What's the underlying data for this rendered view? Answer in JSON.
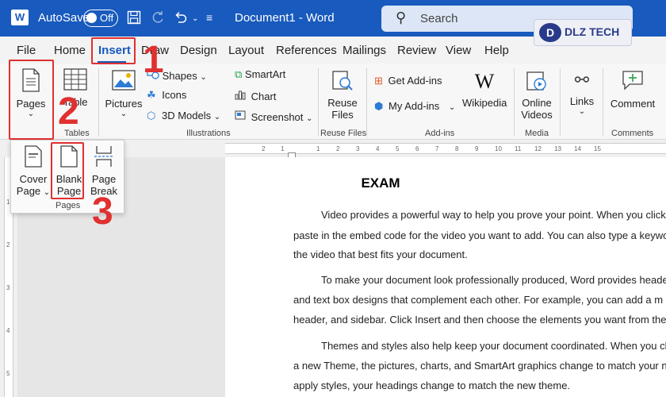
{
  "titlebar": {
    "app_icon": "word-app-icon",
    "autosave_label": "AutoSave",
    "autosave_state": "Off",
    "doc_title": "Document1  -  Word",
    "search_placeholder": "Search",
    "watermark_text": "DLZ TECH",
    "watermark_logo": "D"
  },
  "tabs": [
    "File",
    "Home",
    "Insert",
    "Draw",
    "Design",
    "Layout",
    "References",
    "Mailings",
    "Review",
    "View",
    "Help"
  ],
  "active_tab": "Insert",
  "ribbon": {
    "pages": {
      "label": "Pages"
    },
    "table": {
      "label": "Table"
    },
    "tables_group": "Tables",
    "pictures": {
      "label": "Pictures"
    },
    "shapes": "Shapes",
    "icons": "Icons",
    "models3d": "3D Models",
    "smartart": "SmartArt",
    "chart": "Chart",
    "screenshot": "Screenshot",
    "illustrations_group": "Illustrations",
    "reuse_files_line1": "Reuse",
    "reuse_files_line2": "Files",
    "reuse_files_group": "Reuse Files",
    "get_addins": "Get Add-ins",
    "my_addins": "My Add-ins",
    "wikipedia": "Wikipedia",
    "addins_group": "Add-ins",
    "online_videos_line1": "Online",
    "online_videos_line2": "Videos",
    "media_group": "Media",
    "links": "Links",
    "comment": "Comment",
    "comments_group": "Comments"
  },
  "pages_dropdown": {
    "cover_page_line1": "Cover",
    "cover_page_line2": "Page",
    "blank_page_line1": "Blank",
    "blank_page_line2": "Page",
    "page_break_line1": "Page",
    "page_break_line2": "Break",
    "group": "Pages"
  },
  "ruler_numbers": [
    "1",
    "2",
    "3",
    "4",
    "5",
    "6",
    "7",
    "8",
    "9",
    "10",
    "11",
    "12",
    "13",
    "14",
    "15"
  ],
  "ruler_numbers_left": [
    "1",
    "2"
  ],
  "vruler_numbers": [
    "1",
    "2",
    "3",
    "4",
    "5"
  ],
  "document": {
    "title": "EXAM",
    "lines": [
      "Video provides a powerful way to help you prove your point. When you click O",
      "paste in the embed code for the video you want to add. You can also type a keyword",
      "the video that best fits your document.",
      "To make your document look professionally produced, Word provides header,",
      "and text box designs that complement each other. For example, you can add a m",
      "header, and sidebar. Click Insert and then choose the elements you want from the dif",
      "Themes and styles also help keep your document coordinated. When you click",
      "a new Theme, the pictures, charts, and SmartArt graphics change to match your ne",
      "apply styles, your headings change to match the new theme."
    ]
  },
  "annotations": [
    "1",
    "2",
    "3"
  ],
  "colors": {
    "word_blue": "#185abd",
    "annotation_red": "#e03030"
  }
}
